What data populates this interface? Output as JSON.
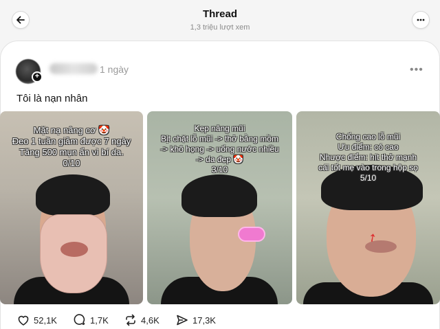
{
  "header": {
    "title": "Thread",
    "subtitle": "1,3 triệu lượt xem"
  },
  "post": {
    "time": "1 ngày",
    "more_label": "•••",
    "text": "Tôi là nạn nhân"
  },
  "photos": [
    {
      "caption_lines": [
        "Mặt nạ nâng cơ 🤡",
        "Đeo 1 tuần giảm được 7 ngày",
        "Tăng 500 mụn ẩn vì bí da.",
        "0/10"
      ]
    },
    {
      "caption_lines": [
        "Kẹp nâng mũi",
        "Bịt chặt lỗ mũi -> thở bằng mồm",
        "-> khô họng -> uống nước nhiều",
        "-> da đẹp 🤡",
        "3/10"
      ]
    },
    {
      "caption_lines": [
        "Chống cao lỗ mũi",
        "Ưu điểm: có cao",
        "Nhược điểm: hít thở mạnh",
        "cái tốt mẹ vào trong hộp sọ",
        "5/10"
      ]
    }
  ],
  "actions": {
    "likes": "52,1K",
    "comments": "1,7K",
    "reposts": "4,6K",
    "shares": "17,3K"
  },
  "icons": {
    "back": "arrow-left-icon",
    "more": "ellipsis-icon",
    "like": "heart-icon",
    "comment": "comment-icon",
    "repost": "repost-icon",
    "share": "send-icon"
  }
}
